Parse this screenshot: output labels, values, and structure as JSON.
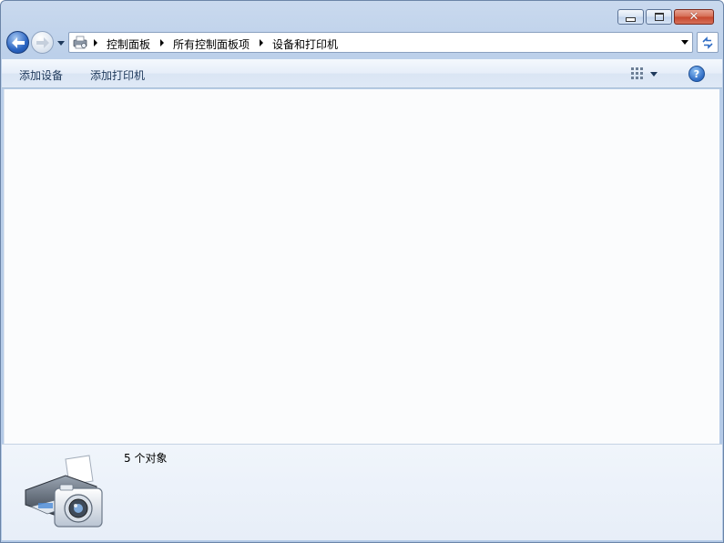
{
  "window": {
    "caption_buttons": [
      "minimize",
      "maximize",
      "close"
    ]
  },
  "navigation": {
    "back_icon": "back-arrow-icon",
    "forward_icon": "forward-arrow-icon",
    "recent_pages_icon": "chevron-down-icon"
  },
  "address_bar": {
    "location_icon": "devices-printers-icon",
    "breadcrumbs": [
      "控制面板",
      "所有控制面板项",
      "设备和打印机"
    ]
  },
  "toolbar": {
    "add_device_label": "添加设备",
    "add_printer_label": "添加打印机",
    "views_icon": "view-grid-icon",
    "help_icon": "help-icon",
    "help_glyph": "?"
  },
  "details_pane": {
    "icon": "printer-camera-icon",
    "item_count": "5 个对象"
  },
  "colors": {
    "frame": "#bcd0ea",
    "content_bg": "#fbfcfd",
    "close_red": "#c6462c",
    "text_blue": "#1e395b"
  }
}
